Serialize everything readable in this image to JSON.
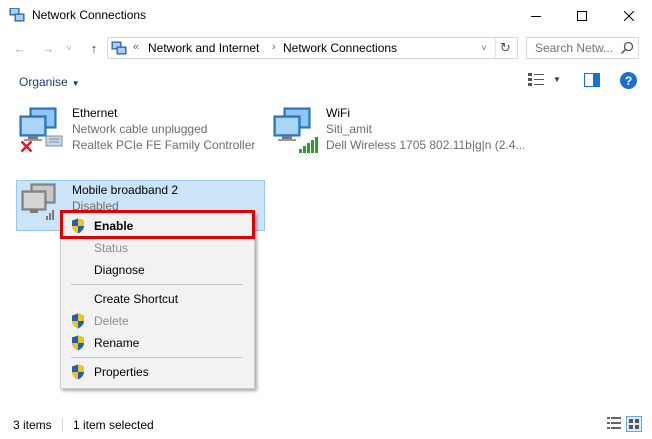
{
  "window": {
    "title": "Network Connections",
    "controls": {
      "minimize": "—",
      "maximize": "☐",
      "close": "✕"
    }
  },
  "nav": {
    "back": "←",
    "forward": "→",
    "recent": "˅",
    "up": "↑",
    "overflow": "«",
    "breadcrumbs": [
      "Network and Internet",
      "Network Connections"
    ],
    "separator": "›",
    "dropdown": "˅",
    "refresh": "↻",
    "search_placeholder": "Search Netw..."
  },
  "commandbar": {
    "organise_label": "Organise",
    "organise_caret": "▼",
    "view_caret": "▼",
    "help": "?"
  },
  "connections": [
    {
      "name": "Ethernet",
      "status": "Network cable unplugged",
      "device": "Realtek PCIe FE Family Controller",
      "state": "disconnected"
    },
    {
      "name": "WiFi",
      "status": "Siti_amit",
      "device": "Dell Wireless 1705 802.11b|g|n (2.4...",
      "state": "connected"
    },
    {
      "name": "Mobile broadband 2",
      "status": "Disabled",
      "state": "disabled",
      "selected": true
    }
  ],
  "context_menu": {
    "items": [
      {
        "label": "Enable",
        "shield": true,
        "bold": true,
        "disabled": false
      },
      {
        "label": "Status",
        "shield": false,
        "disabled": true
      },
      {
        "label": "Diagnose",
        "shield": false,
        "disabled": false
      },
      {
        "label": "Create Shortcut",
        "shield": false,
        "disabled": false
      },
      {
        "label": "Delete",
        "shield": true,
        "disabled": true
      },
      {
        "label": "Rename",
        "shield": true,
        "disabled": false
      },
      {
        "label": "Properties",
        "shield": true,
        "disabled": false
      }
    ],
    "highlighted_item": "Enable",
    "highlight_color": "#e00000"
  },
  "statusbar": {
    "item_count": "3 items",
    "selection": "1 item selected"
  },
  "colors": {
    "selection_bg": "#cce4f7",
    "selection_border": "#99c9ef",
    "accent": "#1c6fd0",
    "error_x": "#e81123",
    "signal_green": "#2f9e2f"
  }
}
